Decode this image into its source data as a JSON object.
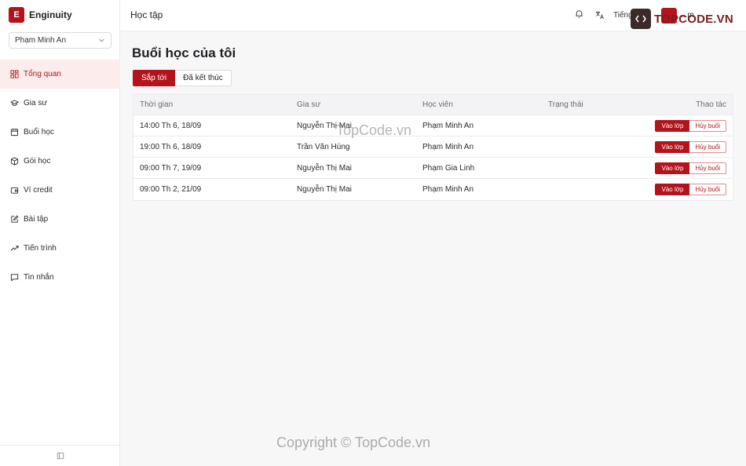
{
  "brand": {
    "logo_letter": "E",
    "name": "Enginuity"
  },
  "user_select": {
    "value": "Phạm Minh An"
  },
  "nav": [
    {
      "label": "Tổng quan",
      "icon": "dashboard-icon",
      "active": true
    },
    {
      "label": "Gia sư",
      "icon": "graduation-cap-icon",
      "active": false
    },
    {
      "label": "Buổi học",
      "icon": "calendar-icon",
      "active": false
    },
    {
      "label": "Gói học",
      "icon": "package-icon",
      "active": false
    },
    {
      "label": "Ví credit",
      "icon": "wallet-icon",
      "active": false
    },
    {
      "label": "Bài tập",
      "icon": "edit-icon",
      "active": false
    },
    {
      "label": "Tiến trình",
      "icon": "trending-up-icon",
      "active": false
    },
    {
      "label": "Tin nhắn",
      "icon": "message-icon",
      "active": false
    }
  ],
  "topbar": {
    "title": "Học tập",
    "lang": "Tiếng",
    "user_name": "...m"
  },
  "page": {
    "title": "Buổi học của tôi"
  },
  "tabs": [
    "Sắp tới",
    "Đã kết thúc"
  ],
  "table": {
    "headers": [
      "Thời gian",
      "Gia sư",
      "Học viên",
      "Trạng thái",
      "Thao tác"
    ],
    "rows": [
      {
        "time": "14:00 Th 6, 18/09",
        "tutor": "Nguyễn Thị Mai",
        "student": "Phạm Minh An",
        "status": ""
      },
      {
        "time": "19:00 Th 6, 18/09",
        "tutor": "Trần Văn Hùng",
        "student": "Phạm Minh An",
        "status": ""
      },
      {
        "time": "09:00 Th 7, 19/09",
        "tutor": "Nguyễn Thị Mai",
        "student": "Phạm Gia Linh",
        "status": ""
      },
      {
        "time": "09:00 Th 2, 21/09",
        "tutor": "Nguyễn Thị Mai",
        "student": "Phạm Minh An",
        "status": ""
      }
    ],
    "join_label": "Vào lớp",
    "cancel_label": "Hủy buổi"
  },
  "watermark": {
    "mid": "TopCode.vn",
    "bottom": "Copyright © TopCode.vn",
    "logo_text": "TOPCODE.VN"
  },
  "colors": {
    "accent": "#b3141b",
    "active_bg": "#fdecec"
  }
}
